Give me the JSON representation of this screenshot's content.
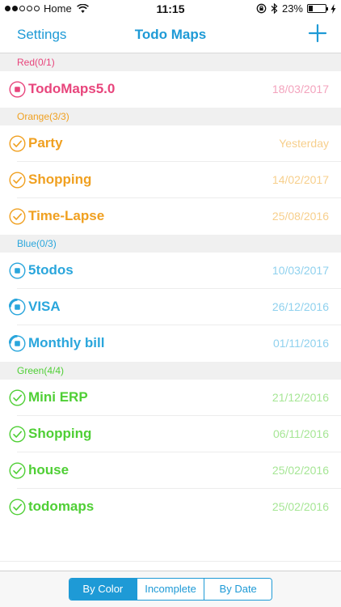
{
  "status": {
    "carrier": "Home",
    "time": "11:15",
    "battery_text": "23%",
    "battery_level": 0.23
  },
  "nav": {
    "left_label": "Settings",
    "title": "Todo Maps",
    "add_icon": "plus-icon"
  },
  "colors": {
    "accent": "#1e9ad6",
    "red": "#e8457c",
    "red_light": "#f3a3bd",
    "orange": "#f0a020",
    "orange_light": "#f7cf8c",
    "blue": "#2aa6dc",
    "blue_light": "#8fd1ee",
    "green": "#4fcf35",
    "green_light": "#a6e695"
  },
  "sections": [
    {
      "header": "Red(0/1)",
      "color": "#e8457c",
      "light": "#f3a3bd",
      "items": [
        {
          "title": "TodoMaps5.0",
          "date": "18/03/2017",
          "icon": "stop-icon"
        }
      ]
    },
    {
      "header": "Orange(3/3)",
      "color": "#f0a020",
      "light": "#f7cf8c",
      "items": [
        {
          "title": "Party",
          "date": "Yesterday",
          "icon": "check-icon"
        },
        {
          "title": "Shopping",
          "date": "14/02/2017",
          "icon": "check-icon"
        },
        {
          "title": "Time-Lapse",
          "date": "25/08/2016",
          "icon": "check-icon"
        }
      ]
    },
    {
      "header": "Blue(0/3)",
      "color": "#2aa6dc",
      "light": "#8fd1ee",
      "items": [
        {
          "title": "5todos",
          "date": "10/03/2017",
          "icon": "stop-icon"
        },
        {
          "title": "VISA",
          "date": "26/12/2016",
          "icon": "partial-progress-icon"
        },
        {
          "title": "Monthly bill",
          "date": "01/11/2016",
          "icon": "partial-progress-icon"
        }
      ]
    },
    {
      "header": "Green(4/4)",
      "color": "#4fcf35",
      "light": "#a6e695",
      "items": [
        {
          "title": "Mini ERP",
          "date": "21/12/2016",
          "icon": "check-icon"
        },
        {
          "title": "Shopping",
          "date": "06/11/2016",
          "icon": "check-icon"
        },
        {
          "title": "house",
          "date": "25/02/2016",
          "icon": "check-icon"
        },
        {
          "title": "todomaps",
          "date": "25/02/2016",
          "icon": "check-icon"
        }
      ]
    }
  ],
  "tabs": [
    {
      "label": "By Color",
      "active": true
    },
    {
      "label": "Incomplete",
      "active": false
    },
    {
      "label": "By Date",
      "active": false
    }
  ]
}
